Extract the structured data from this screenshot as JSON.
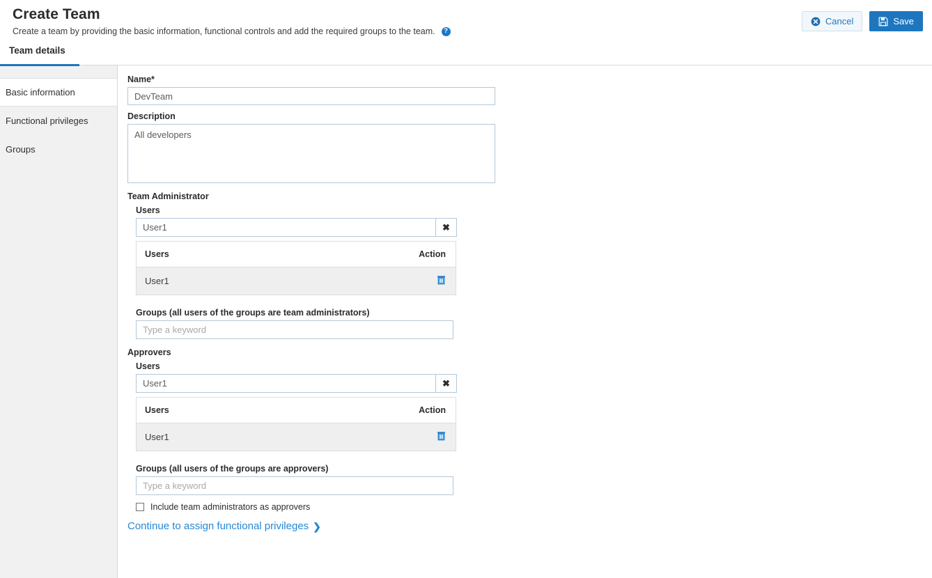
{
  "header": {
    "title": "Create Team",
    "subtitle": "Create a team by providing the basic information, functional controls and add the required groups to the team.",
    "help_icon": "help-circle-icon",
    "cancel_label": "Cancel",
    "save_label": "Save",
    "cancel_icon": "cancel-circle-icon",
    "save_icon": "floppy-disk-icon"
  },
  "tabs": [
    {
      "label": "Team details",
      "active": true
    }
  ],
  "sidebar": {
    "items": [
      {
        "label": "Basic information",
        "active": true
      },
      {
        "label": "Functional privileges",
        "active": false
      },
      {
        "label": "Groups",
        "active": false
      }
    ]
  },
  "form": {
    "name": {
      "label": "Name*",
      "value": "DevTeam"
    },
    "description": {
      "label": "Description",
      "value": "All developers"
    },
    "team_administrator": {
      "label": "Team Administrator",
      "users_label": "Users",
      "users_value": "User1",
      "clear_icon": "clear-x-icon",
      "table": {
        "columns": [
          "Users",
          "Action"
        ],
        "rows": [
          {
            "user": "User1",
            "action_icon": "trash-icon"
          }
        ]
      },
      "groups_label": "Groups (all users of the groups are team administrators)",
      "groups_placeholder": "Type a keyword",
      "groups_value": ""
    },
    "approvers": {
      "label": "Approvers",
      "users_label": "Users",
      "users_value": "User1",
      "clear_icon": "clear-x-icon",
      "table": {
        "columns": [
          "Users",
          "Action"
        ],
        "rows": [
          {
            "user": "User1",
            "action_icon": "trash-icon"
          }
        ]
      },
      "groups_label": "Groups (all users of the groups are approvers)",
      "groups_placeholder": "Type a keyword",
      "groups_value": "",
      "include_admins_label": "Include team administrators as approvers",
      "include_admins_checked": false
    },
    "continue_link": {
      "label": "Continue to assign functional privileges",
      "chevron": "chevron-right-icon"
    }
  },
  "colors": {
    "accent": "#1e76bf",
    "link": "#2488d6",
    "input_border": "#b4c7d8",
    "sidebar_bg": "#f1f1f1",
    "row_bg": "#efefef"
  }
}
